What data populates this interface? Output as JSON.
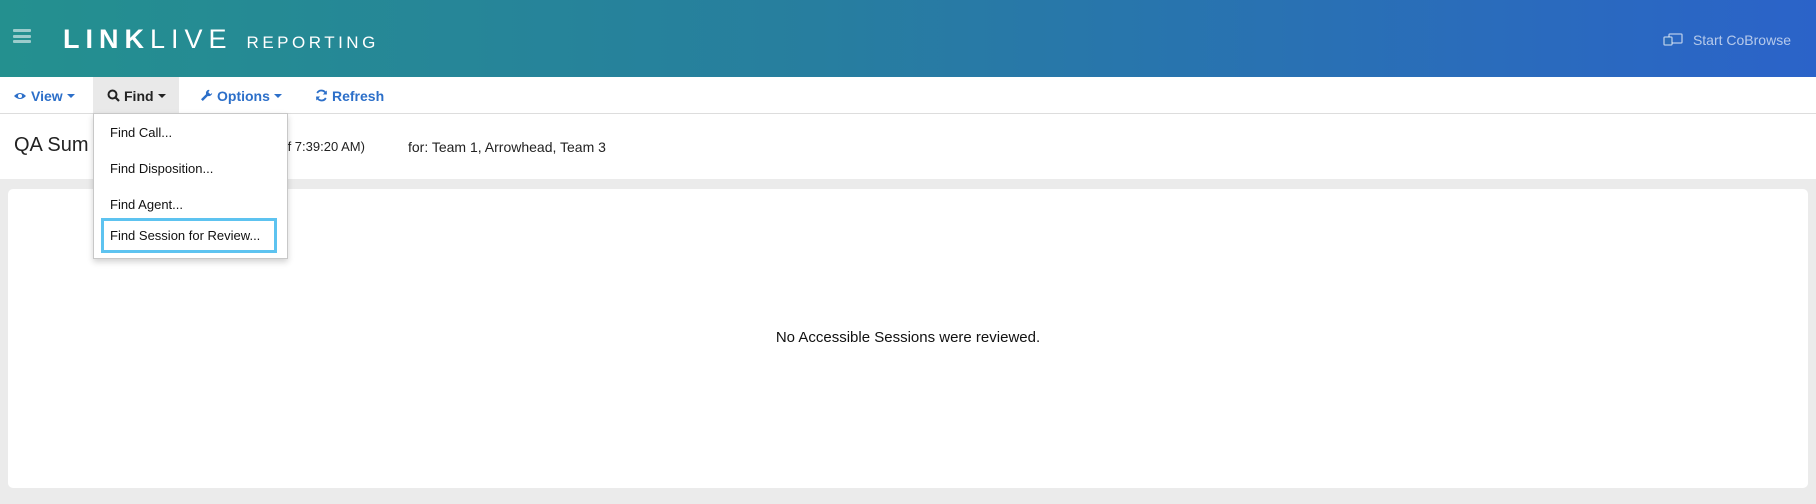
{
  "header": {
    "logo_link": "LINK",
    "logo_live": "LIVE",
    "logo_reporting": "REPORTING",
    "cobrowse_label": "Start CoBrowse",
    "gradient_start": "#24908f",
    "gradient_end": "#2b63c9"
  },
  "menubar": {
    "view": {
      "label": "View",
      "icon": "eye-icon"
    },
    "find": {
      "label": "Find",
      "icon": "search-icon"
    },
    "options": {
      "label": "Options",
      "icon": "wrench-icon"
    },
    "refresh": {
      "label": "Refresh",
      "icon": "refresh-icon"
    },
    "accent": "#2c6fc9"
  },
  "find_menu": {
    "items": [
      {
        "label": "Find Call..."
      },
      {
        "label": "Find Disposition..."
      },
      {
        "label": "Find Agent..."
      },
      {
        "label": "Find Session for Review..."
      }
    ],
    "focus_color": "#5dc3f0"
  },
  "subheader": {
    "title": "QA Sum",
    "as_of": "as of 7:39:20 AM)",
    "for_teams": "for: Team 1, Arrowhead, Team 3"
  },
  "main": {
    "empty_message": "No Accessible Sessions were reviewed."
  }
}
